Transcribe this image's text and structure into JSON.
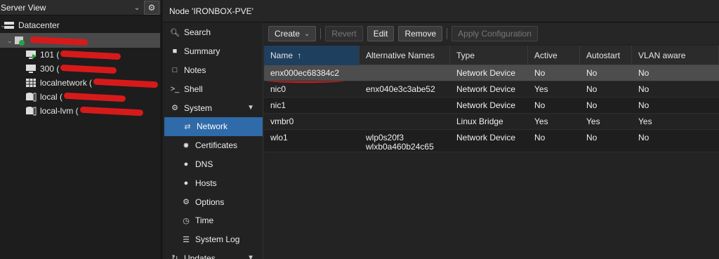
{
  "tree": {
    "header_title": "Server View",
    "items": [
      {
        "label": "Datacenter"
      },
      {
        "label": "101 ("
      },
      {
        "label": "300 ("
      },
      {
        "label": "localnetwork ("
      },
      {
        "label": "local ("
      },
      {
        "label": "local-lvm ("
      }
    ]
  },
  "panel": {
    "title": "Node 'IRONBOX-PVE'"
  },
  "nav": {
    "items": [
      {
        "label": "Search",
        "icon": "search-icon"
      },
      {
        "label": "Summary",
        "icon": "book-icon"
      },
      {
        "label": "Notes",
        "icon": "notes-icon"
      },
      {
        "label": "Shell",
        "icon": "terminal-icon"
      },
      {
        "label": "System",
        "icon": "gears-icon"
      },
      {
        "label": "Network",
        "icon": "exchange-icon"
      },
      {
        "label": "Certificates",
        "icon": "certificate-icon"
      },
      {
        "label": "DNS",
        "icon": "globe-icon"
      },
      {
        "label": "Hosts",
        "icon": "globe-icon"
      },
      {
        "label": "Options",
        "icon": "gear-icon"
      },
      {
        "label": "Time",
        "icon": "clock-icon"
      },
      {
        "label": "System Log",
        "icon": "list-icon"
      },
      {
        "label": "Updates",
        "icon": "refresh-icon"
      }
    ]
  },
  "toolbar": {
    "create": "Create",
    "revert": "Revert",
    "edit": "Edit",
    "remove": "Remove",
    "apply": "Apply Configuration"
  },
  "grid": {
    "columns": [
      "Name",
      "Alternative Names",
      "Type",
      "Active",
      "Autostart",
      "VLAN aware"
    ],
    "rows": [
      {
        "name": "enx000ec68384c2",
        "alt1": "",
        "alt2": "",
        "type": "Network Device",
        "active": "No",
        "autostart": "No",
        "vlan": "No"
      },
      {
        "name": "nic0",
        "alt1": "enx040e3c3abe52",
        "alt2": "",
        "type": "Network Device",
        "active": "Yes",
        "autostart": "No",
        "vlan": "No"
      },
      {
        "name": "nic1",
        "alt1": "",
        "alt2": "",
        "type": "Network Device",
        "active": "No",
        "autostart": "No",
        "vlan": "No"
      },
      {
        "name": "vmbr0",
        "alt1": "",
        "alt2": "",
        "type": "Linux Bridge",
        "active": "Yes",
        "autostart": "Yes",
        "vlan": "Yes"
      },
      {
        "name": "wlo1",
        "alt1": "wlp0s20f3",
        "alt2": "wlxb0a460b24c65",
        "type": "Network Device",
        "active": "No",
        "autostart": "No",
        "vlan": "No"
      }
    ]
  },
  "colors": {
    "accent": "#2f6aa9",
    "redaction": "#d61a1a"
  }
}
